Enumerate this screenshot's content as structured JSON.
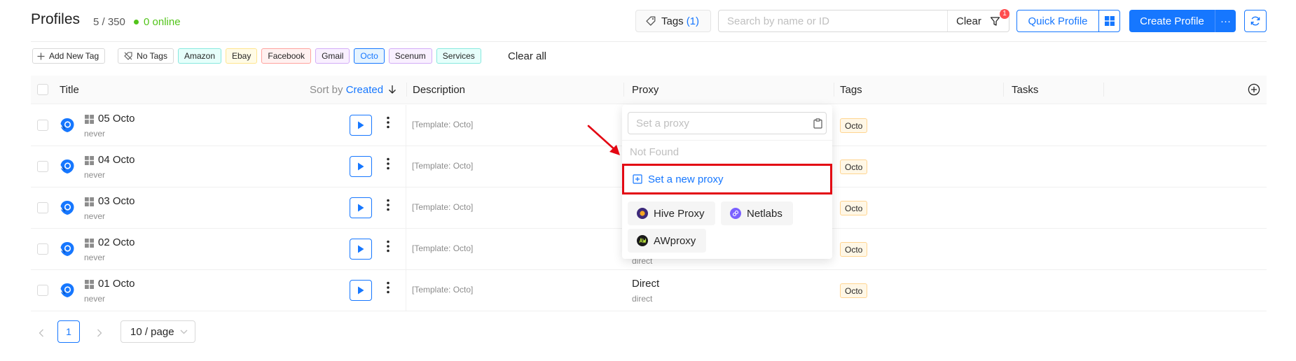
{
  "header": {
    "title": "Profiles",
    "count": "5 / 350",
    "online": "0 online",
    "tags_label": "Tags",
    "tags_count": "(1)",
    "search_placeholder": "Search by name or ID",
    "clear_label": "Clear",
    "filter_badge": "1",
    "quick_profile": "Quick Profile",
    "create_profile": "Create Profile",
    "create_more": "···"
  },
  "tag_filter": {
    "add_label": "Add New Tag",
    "no_tags_label": "No Tags",
    "tags": [
      {
        "name": "Amazon",
        "bg": "#e6fffb",
        "border": "#87e8de"
      },
      {
        "name": "Ebay",
        "bg": "#fffbe6",
        "border": "#ffe58f"
      },
      {
        "name": "Facebook",
        "bg": "#fff1f0",
        "border": "#ffa39e"
      },
      {
        "name": "Gmail",
        "bg": "#f9f0ff",
        "border": "#d3adf7"
      },
      {
        "name": "Octo",
        "bg": "#e6f4ff",
        "border": "#1677ff"
      },
      {
        "name": "Scenum",
        "bg": "#f9f0ff",
        "border": "#d3adf7"
      },
      {
        "name": "Services",
        "bg": "#e6fffb",
        "border": "#87e8de"
      }
    ],
    "clear_all": "Clear all"
  },
  "table": {
    "columns": {
      "title": "Title",
      "sort_by": "Sort by",
      "sort_value": "Created",
      "description": "Description",
      "proxy": "Proxy",
      "tags": "Tags",
      "tasks": "Tasks"
    },
    "rows": [
      {
        "name": "05 Octo",
        "last_used": "never",
        "description": "[Template: Octo]",
        "tag": "Octo"
      },
      {
        "name": "04 Octo",
        "last_used": "never",
        "description": "[Template: Octo]",
        "tag": "Octo"
      },
      {
        "name": "03 Octo",
        "last_used": "never",
        "description": "[Template: Octo]",
        "tag": "Octo"
      },
      {
        "name": "02 Octo",
        "last_used": "never",
        "description": "[Template: Octo]",
        "tag": "Octo"
      },
      {
        "name": "01 Octo",
        "last_used": "never",
        "description": "[Template: Octo]",
        "tag": "Octo",
        "proxy": "Direct",
        "proxy_type": "direct"
      }
    ],
    "partial_proxy_text": "direct"
  },
  "pagination": {
    "current_page": "1",
    "page_size": "10 / page"
  },
  "proxy_dropdown": {
    "placeholder": "Set a proxy",
    "not_found": "Not Found",
    "set_new": "Set a new proxy",
    "providers": [
      {
        "name": "Hive Proxy",
        "icon": "hive-proxy-icon",
        "color": "#f5a623"
      },
      {
        "name": "Netlabs",
        "icon": "netlabs-icon",
        "color": "#7b61ff"
      },
      {
        "name": "AWproxy",
        "icon": "awproxy-icon",
        "color": "#1a1a1a"
      }
    ]
  },
  "colors": {
    "accent": "#1677ff",
    "online": "#52c41a",
    "highlight": "#e30613",
    "tag_bg": "#fff7e6"
  }
}
